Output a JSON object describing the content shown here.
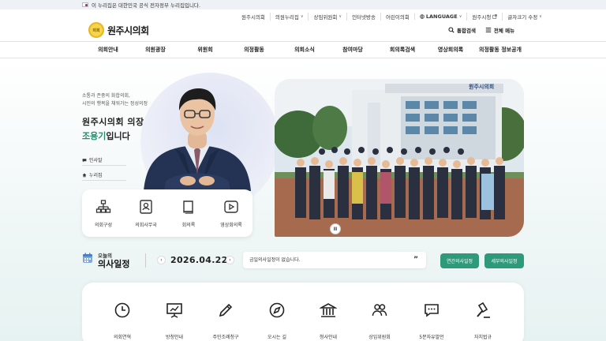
{
  "gov_banner": {
    "text": "이 누리집은 대한민국 공식 전자정부 누리집입니다."
  },
  "utility": [
    {
      "label": "원주시의회",
      "icon": ""
    },
    {
      "label": "의원누리집",
      "icon": "chevron-down-icon"
    },
    {
      "label": "상임위원회",
      "icon": "chevron-down-icon"
    },
    {
      "label": "인터넷방송",
      "icon": ""
    },
    {
      "label": "어린이의회",
      "icon": ""
    },
    {
      "label": "LANGUAGE",
      "icon": "globe-icon"
    },
    {
      "label": "원주시청",
      "icon": "external-link-icon"
    },
    {
      "label": "글자크기 수정",
      "icon": "chevron-down-icon"
    }
  ],
  "logo": {
    "emblem_text": "의회",
    "name": "원주시의회"
  },
  "tools": {
    "search": "통합검색",
    "menu": "전체 메뉴"
  },
  "nav": [
    "의회안내",
    "의원광장",
    "위원회",
    "의정활동",
    "의회소식",
    "참여마당",
    "회의록검색",
    "영상회의록",
    "의정활동 정보공개"
  ],
  "chair": {
    "tagline1": "소통과 존중의 화합의회,",
    "tagline2": "시민의 행복을 채워가는 정성의정",
    "title": "원주시의회 의장",
    "name": "조용기",
    "suffix": "입니다",
    "links": [
      {
        "label": "인사말",
        "icon": "chat-icon"
      },
      {
        "label": "누리집",
        "icon": "home-icon"
      }
    ]
  },
  "quick": [
    {
      "label": "의회구성",
      "icon": "org-chart-icon"
    },
    {
      "label": "의회사무국",
      "icon": "id-card-icon"
    },
    {
      "label": "회의록",
      "icon": "book-icon"
    },
    {
      "label": "영상회의록",
      "icon": "play-icon"
    }
  ],
  "photo": {
    "pause_label": "II",
    "building_sign": "원주시의회"
  },
  "schedule": {
    "label": "오늘의",
    "title": "의사일정",
    "date": "2026.04.22",
    "prev": "‹",
    "next": "›",
    "message": "금일의사일정이 없습니다.",
    "quote": "”",
    "buttons": [
      "연간의사일정",
      "세부의사일정"
    ]
  },
  "bottom_menu": [
    {
      "label": "의회연혁",
      "icon": "clock-icon"
    },
    {
      "label": "방청안내",
      "icon": "presentation-icon"
    },
    {
      "label": "주민조례청구",
      "icon": "pencil-icon"
    },
    {
      "label": "오시는 길",
      "icon": "compass-icon"
    },
    {
      "label": "청사안내",
      "icon": "building-icon"
    },
    {
      "label": "상임위원회",
      "icon": "people-icon"
    },
    {
      "label": "5분자유발언",
      "icon": "speech-icon"
    },
    {
      "label": "자치법규",
      "icon": "gavel-icon"
    }
  ],
  "colors": {
    "accent_green": "#2f9a79",
    "emblem_gold": "#f2c230",
    "name_green": "#2a8a6a"
  }
}
